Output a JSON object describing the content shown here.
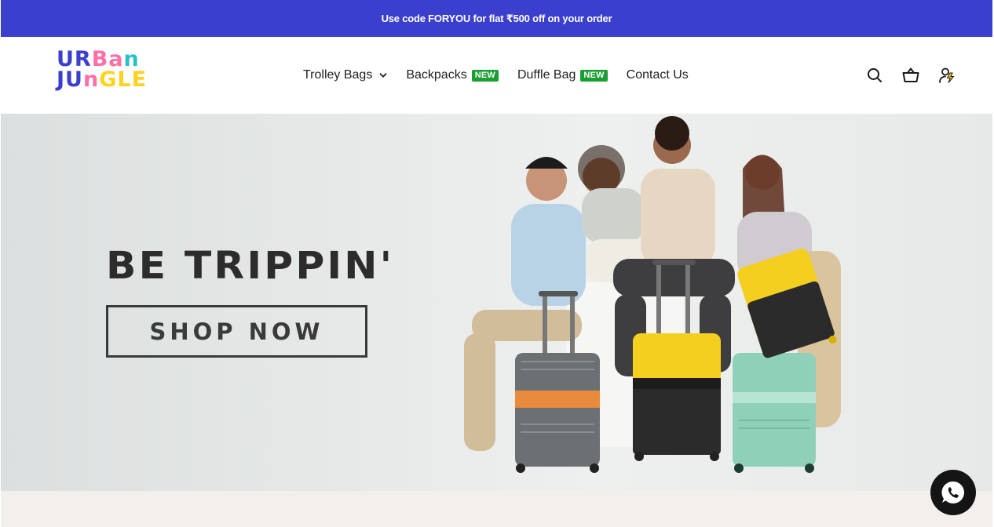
{
  "announcement": {
    "text": "Use code FORYOU for flat ₹500 off on your order"
  },
  "header": {
    "logo": {
      "line1": [
        "UR",
        "Ba",
        "n"
      ],
      "line2": [
        "JU",
        "n",
        "GLE"
      ]
    },
    "nav": [
      {
        "label": "Trolley Bags",
        "has_dropdown": true,
        "badge": ""
      },
      {
        "label": "Backpacks",
        "badge": "NEW"
      },
      {
        "label": "Duffle Bag",
        "badge": "NEW"
      },
      {
        "label": "Contact Us",
        "badge": ""
      }
    ],
    "icons": [
      "search-icon",
      "cart-icon",
      "account-icon"
    ]
  },
  "hero": {
    "title": "BE TRIPPIN'",
    "cta": "SHOP NOW"
  },
  "colors": {
    "brand": "#3a3fce",
    "badge": "#1a9e34",
    "text": "#1f1f1f"
  }
}
